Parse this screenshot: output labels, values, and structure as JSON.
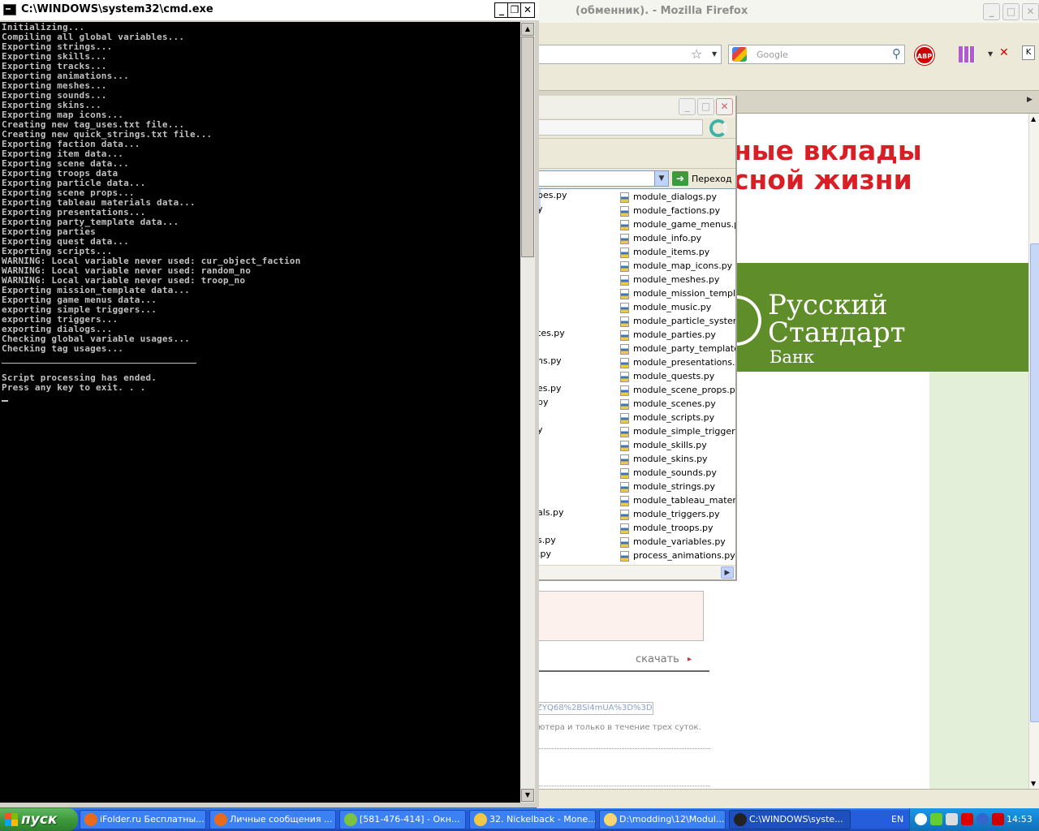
{
  "firefox": {
    "title": "(обменник). - Mozilla Firefox",
    "search_placeholder": "Google",
    "abp_label": "ABP",
    "ad_line1": "ные вклады",
    "ad_line2": "сной жизни",
    "bank_line1": "Русский",
    "bank_line2": "Стандарт",
    "bank_line3": "Банк",
    "download_label": "скачать",
    "link_fragment": "ZYQ68%2BSl4mUA%3D%3D",
    "note_fragment": "ютера и только в течение трех суток.",
    "colors": {
      "ad_red": "#d91f26",
      "bank_green": "#5e8d2a"
    }
  },
  "explorer": {
    "go_label": "Переход",
    "left_fragments": [
      {
        "text": "pes.py"
      },
      {
        "text": "y"
      },
      {
        "text": "tes.py"
      },
      {
        "text": "ns.py"
      },
      {
        "text": "es.py"
      },
      {
        "text": "py"
      },
      {
        "text": "y"
      },
      {
        "text": "als.py"
      },
      {
        "text": "s.py"
      },
      {
        "text": ".py"
      }
    ],
    "files": [
      "module_dialogs.py",
      "module_factions.py",
      "module_game_menus.py",
      "module_info.py",
      "module_items.py",
      "module_map_icons.py",
      "module_meshes.py",
      "module_mission_templates.py",
      "module_music.py",
      "module_particle_systems.py",
      "module_parties.py",
      "module_party_templates.py",
      "module_presentations.py",
      "module_quests.py",
      "module_scene_props.py",
      "module_scenes.py",
      "module_scripts.py",
      "module_simple_triggers.py",
      "module_skills.py",
      "module_skins.py",
      "module_sounds.py",
      "module_strings.py",
      "module_tableau_materials.py",
      "module_triggers.py",
      "module_troops.py",
      "module_variables.py",
      "process_animations.py"
    ]
  },
  "cmd": {
    "title": "C:\\WINDOWS\\system32\\cmd.exe",
    "lines": [
      "Initializing...",
      "Compiling all global variables...",
      "Exporting strings...",
      "Exporting skills...",
      "Exporting tracks...",
      "Exporting animations...",
      "Exporting meshes...",
      "Exporting sounds...",
      "Exporting skins...",
      "Exporting map icons...",
      "Creating new tag_uses.txt file...",
      "Creating new quick_strings.txt file...",
      "Exporting faction data...",
      "Exporting item data...",
      "Exporting scene data...",
      "Exporting troops data",
      "Exporting particle data...",
      "Exporting scene props...",
      "Exporting tableau materials data...",
      "Exporting presentations...",
      "Exporting party_template data...",
      "Exporting parties",
      "Exporting quest data...",
      "Exporting scripts...",
      "WARNING: Local variable never used: cur_object_faction",
      "WARNING: Local variable never used: random_no",
      "WARNING: Local variable never used: troop_no",
      "Exporting mission_template data...",
      "Exporting game menus data...",
      "exporting simple triggers...",
      "exporting triggers...",
      "exporting dialogs...",
      "Checking global variable usages...",
      "Checking tag usages..."
    ],
    "end_lines": [
      "Script processing has ended.",
      "Press any key to exit. . ."
    ]
  },
  "taskbar": {
    "start_label": "пуск",
    "tasks": [
      {
        "label": "iFolder.ru Бесплатны...",
        "icon_color": "#e86a1c"
      },
      {
        "label": "Личные сообщения ...",
        "icon_color": "#e86a1c"
      },
      {
        "label": "[581-476-414] - Окн...",
        "icon_color": "#7cc242"
      },
      {
        "label": "32. Nickelback - Mone...",
        "icon_color": "#f2c744"
      },
      {
        "label": "D:\\modding\\12\\Modul...",
        "icon_color": "#f5d76e"
      },
      {
        "label": "C:\\WINDOWS\\syste...",
        "icon_color": "#222222"
      }
    ],
    "language": "EN",
    "clock": "14:53"
  }
}
